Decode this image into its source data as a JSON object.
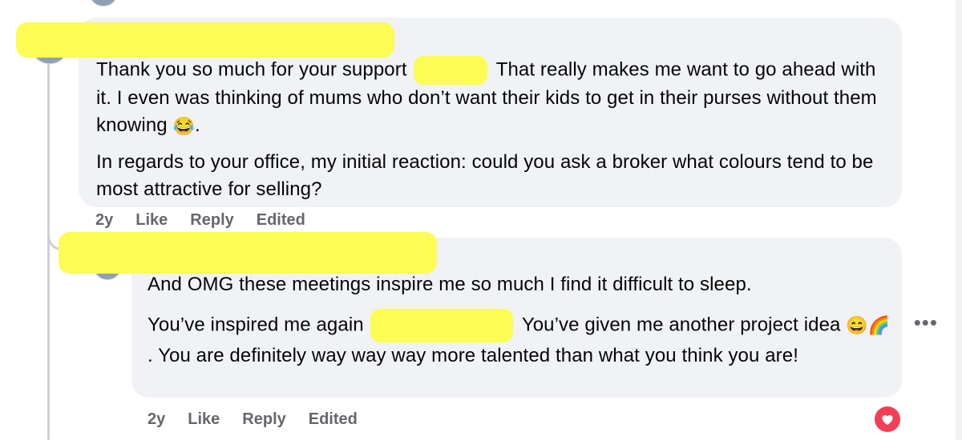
{
  "comment1": {
    "text_before": "Thank you so much for your support",
    "text_after": "That really makes me want to go ahead with it. I even was thinking of mums who don’t want their kids to get in their purses without them knowing",
    "emoji1": "😂",
    "text_end": ".",
    "para2": "In regards to your office, my initial reaction: could you ask a broker what colours tend to be most attractive for selling?",
    "time": "2y",
    "like": "Like",
    "reply": "Reply",
    "edited": "Edited"
  },
  "comment2": {
    "para1": "And OMG these meetings inspire me so much I find it difficult to sleep.",
    "text_before": "You’ve inspired me again",
    "text_after": "You’ve given me another project idea",
    "emoji1": "😄",
    "emoji2": "🌈",
    "text_rest": ". You are definitely way way way more talented than what you think you are!",
    "time": "2y",
    "like": "Like",
    "reply": "Reply",
    "edited": "Edited",
    "more": "•••",
    "reaction_icon": "heart-icon"
  },
  "colors": {
    "bubble": "#f0f2f5",
    "redaction": "#fcfc55",
    "meta": "#65676b",
    "heart": "#f33e58"
  }
}
